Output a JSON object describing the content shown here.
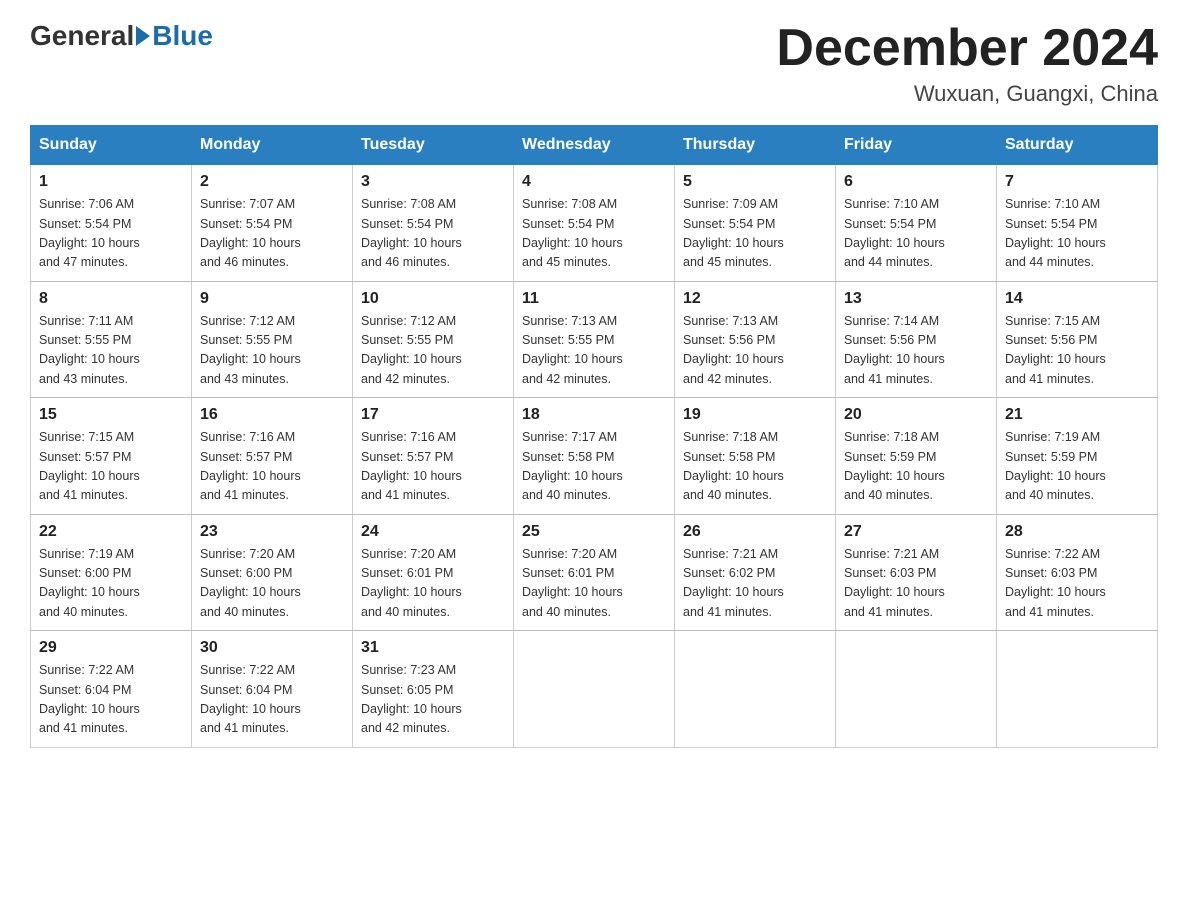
{
  "header": {
    "logo_text_general": "General",
    "logo_text_blue": "Blue",
    "month_title": "December 2024",
    "location": "Wuxuan, Guangxi, China"
  },
  "days_of_week": [
    "Sunday",
    "Monday",
    "Tuesday",
    "Wednesday",
    "Thursday",
    "Friday",
    "Saturday"
  ],
  "weeks": [
    [
      {
        "day": "1",
        "sunrise": "7:06 AM",
        "sunset": "5:54 PM",
        "daylight": "10 hours and 47 minutes."
      },
      {
        "day": "2",
        "sunrise": "7:07 AM",
        "sunset": "5:54 PM",
        "daylight": "10 hours and 46 minutes."
      },
      {
        "day": "3",
        "sunrise": "7:08 AM",
        "sunset": "5:54 PM",
        "daylight": "10 hours and 46 minutes."
      },
      {
        "day": "4",
        "sunrise": "7:08 AM",
        "sunset": "5:54 PM",
        "daylight": "10 hours and 45 minutes."
      },
      {
        "day": "5",
        "sunrise": "7:09 AM",
        "sunset": "5:54 PM",
        "daylight": "10 hours and 45 minutes."
      },
      {
        "day": "6",
        "sunrise": "7:10 AM",
        "sunset": "5:54 PM",
        "daylight": "10 hours and 44 minutes."
      },
      {
        "day": "7",
        "sunrise": "7:10 AM",
        "sunset": "5:54 PM",
        "daylight": "10 hours and 44 minutes."
      }
    ],
    [
      {
        "day": "8",
        "sunrise": "7:11 AM",
        "sunset": "5:55 PM",
        "daylight": "10 hours and 43 minutes."
      },
      {
        "day": "9",
        "sunrise": "7:12 AM",
        "sunset": "5:55 PM",
        "daylight": "10 hours and 43 minutes."
      },
      {
        "day": "10",
        "sunrise": "7:12 AM",
        "sunset": "5:55 PM",
        "daylight": "10 hours and 42 minutes."
      },
      {
        "day": "11",
        "sunrise": "7:13 AM",
        "sunset": "5:55 PM",
        "daylight": "10 hours and 42 minutes."
      },
      {
        "day": "12",
        "sunrise": "7:13 AM",
        "sunset": "5:56 PM",
        "daylight": "10 hours and 42 minutes."
      },
      {
        "day": "13",
        "sunrise": "7:14 AM",
        "sunset": "5:56 PM",
        "daylight": "10 hours and 41 minutes."
      },
      {
        "day": "14",
        "sunrise": "7:15 AM",
        "sunset": "5:56 PM",
        "daylight": "10 hours and 41 minutes."
      }
    ],
    [
      {
        "day": "15",
        "sunrise": "7:15 AM",
        "sunset": "5:57 PM",
        "daylight": "10 hours and 41 minutes."
      },
      {
        "day": "16",
        "sunrise": "7:16 AM",
        "sunset": "5:57 PM",
        "daylight": "10 hours and 41 minutes."
      },
      {
        "day": "17",
        "sunrise": "7:16 AM",
        "sunset": "5:57 PM",
        "daylight": "10 hours and 41 minutes."
      },
      {
        "day": "18",
        "sunrise": "7:17 AM",
        "sunset": "5:58 PM",
        "daylight": "10 hours and 40 minutes."
      },
      {
        "day": "19",
        "sunrise": "7:18 AM",
        "sunset": "5:58 PM",
        "daylight": "10 hours and 40 minutes."
      },
      {
        "day": "20",
        "sunrise": "7:18 AM",
        "sunset": "5:59 PM",
        "daylight": "10 hours and 40 minutes."
      },
      {
        "day": "21",
        "sunrise": "7:19 AM",
        "sunset": "5:59 PM",
        "daylight": "10 hours and 40 minutes."
      }
    ],
    [
      {
        "day": "22",
        "sunrise": "7:19 AM",
        "sunset": "6:00 PM",
        "daylight": "10 hours and 40 minutes."
      },
      {
        "day": "23",
        "sunrise": "7:20 AM",
        "sunset": "6:00 PM",
        "daylight": "10 hours and 40 minutes."
      },
      {
        "day": "24",
        "sunrise": "7:20 AM",
        "sunset": "6:01 PM",
        "daylight": "10 hours and 40 minutes."
      },
      {
        "day": "25",
        "sunrise": "7:20 AM",
        "sunset": "6:01 PM",
        "daylight": "10 hours and 40 minutes."
      },
      {
        "day": "26",
        "sunrise": "7:21 AM",
        "sunset": "6:02 PM",
        "daylight": "10 hours and 41 minutes."
      },
      {
        "day": "27",
        "sunrise": "7:21 AM",
        "sunset": "6:03 PM",
        "daylight": "10 hours and 41 minutes."
      },
      {
        "day": "28",
        "sunrise": "7:22 AM",
        "sunset": "6:03 PM",
        "daylight": "10 hours and 41 minutes."
      }
    ],
    [
      {
        "day": "29",
        "sunrise": "7:22 AM",
        "sunset": "6:04 PM",
        "daylight": "10 hours and 41 minutes."
      },
      {
        "day": "30",
        "sunrise": "7:22 AM",
        "sunset": "6:04 PM",
        "daylight": "10 hours and 41 minutes."
      },
      {
        "day": "31",
        "sunrise": "7:23 AM",
        "sunset": "6:05 PM",
        "daylight": "10 hours and 42 minutes."
      },
      null,
      null,
      null,
      null
    ]
  ]
}
